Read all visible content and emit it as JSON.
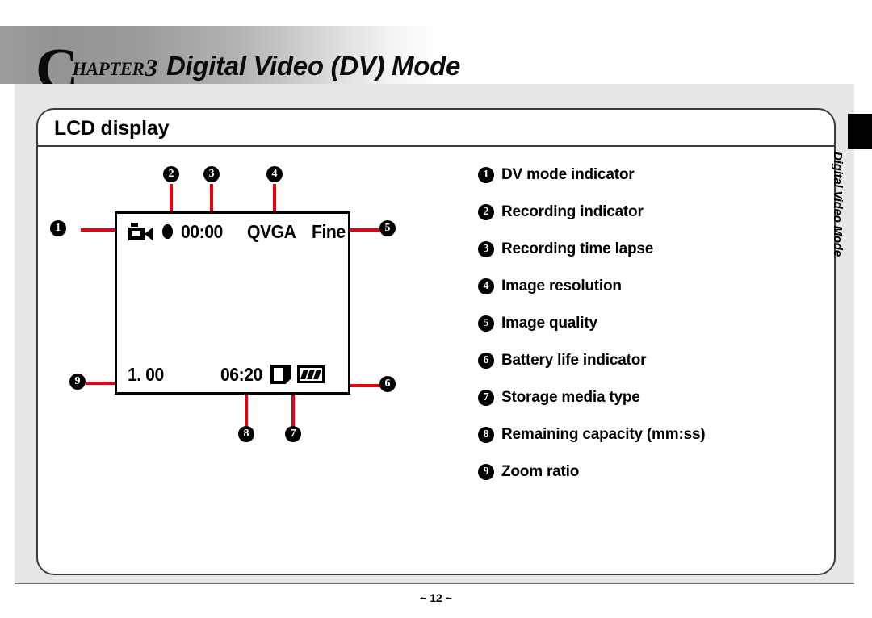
{
  "chapter": {
    "dropcap": "C",
    "word": "HAPTER",
    "number": "3",
    "title": "Digital Video (DV) Mode"
  },
  "section": {
    "title": "LCD display"
  },
  "lcd": {
    "mode_icon": "camcorder-icon",
    "recording_icon": "record-dot-icon",
    "recording_time": "00:00",
    "resolution": "QVGA",
    "quality": "Fine",
    "zoom_ratio": "1. 00",
    "remaining_capacity": "06:20",
    "storage_icon": "sd-card-icon",
    "battery_icon": "battery-icon"
  },
  "markers": {
    "m1": "❶",
    "m2": "❷",
    "m3": "❸",
    "m4": "❹",
    "m5": "❺",
    "m6": "❻",
    "m7": "❼",
    "m8": "❽",
    "m9": "❾"
  },
  "legend": {
    "items": [
      {
        "num": "1",
        "label": "DV mode indicator"
      },
      {
        "num": "2",
        "label": "Recording indicator"
      },
      {
        "num": "3",
        "label": "Recording time lapse"
      },
      {
        "num": "4",
        "label": "Image resolution"
      },
      {
        "num": "5",
        "label": "Image quality"
      },
      {
        "num": "6",
        "label": "Battery life indicator"
      },
      {
        "num": "7",
        "label": "Storage media type"
      },
      {
        "num": "8",
        "label": "Remaining capacity (mm:ss)"
      },
      {
        "num": "9",
        "label": "Zoom ratio"
      }
    ]
  },
  "side_tab": {
    "label": "Digital Video Mode"
  },
  "footer": {
    "page": "~ 12 ~"
  },
  "colors": {
    "leader_line": "#e8000d",
    "panel": "#e6e6e6",
    "border": "#3d3d3d"
  }
}
